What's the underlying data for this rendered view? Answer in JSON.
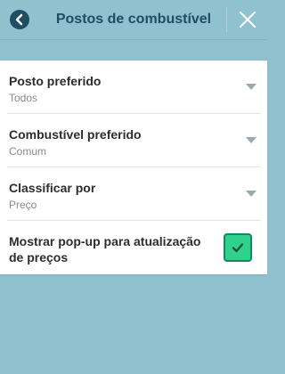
{
  "header": {
    "title": "Postos de combustível",
    "back_icon": "chevron-left-icon",
    "close_icon": "close-icon"
  },
  "settings": {
    "items": [
      {
        "label": "Posto preferido",
        "value": "Todos"
      },
      {
        "label": "Combustível preferido",
        "value": "Comum"
      },
      {
        "label": "Classificar por",
        "value": "Preço"
      }
    ],
    "popup_toggle": {
      "label": "Mostrar pop-up para atualização de preços",
      "checked": true
    }
  },
  "colors": {
    "background": "#8fc2ce",
    "header_text": "#1f4d63",
    "checkbox_fill": "#2fd18c"
  }
}
